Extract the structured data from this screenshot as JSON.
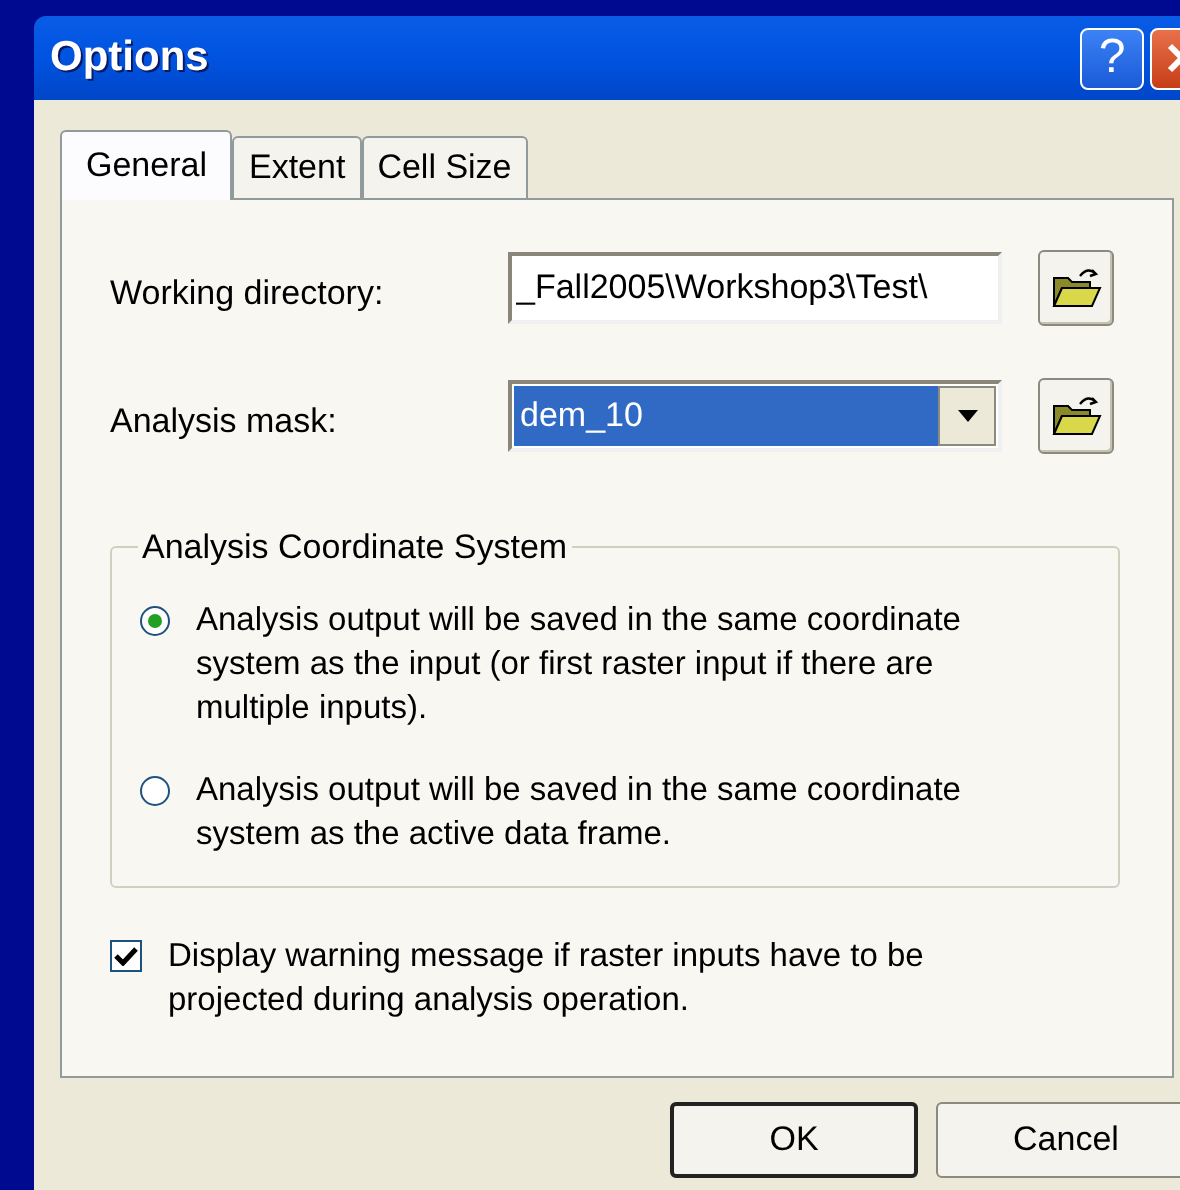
{
  "window": {
    "title": "Options",
    "title_buttons": [
      {
        "kind": "help",
        "label": "?"
      },
      {
        "kind": "close"
      }
    ]
  },
  "tabs": [
    {
      "label": "General",
      "selected": true
    },
    {
      "label": "Extent",
      "selected": false
    },
    {
      "label": "Cell Size",
      "selected": false
    }
  ],
  "working_directory": {
    "label": "Working directory:",
    "value": "_Fall2005\\Workshop3\\Test\\"
  },
  "analysis_mask": {
    "label": "Analysis mask:",
    "value": "dem_10"
  },
  "coordinate_system": {
    "title": "Analysis Coordinate System",
    "options": [
      {
        "label": "Analysis output will be saved in the same coordinate system as the input (or first raster input if there are multiple inputs).",
        "selected": true
      },
      {
        "label": "Analysis output will be saved in the same coordinate system as the active data frame.",
        "selected": false
      }
    ]
  },
  "warning_checkbox": {
    "label": "Display warning message if raster inputs have to be projected during analysis operation.",
    "checked": true
  },
  "buttons": [
    "OK",
    "Cancel"
  ]
}
